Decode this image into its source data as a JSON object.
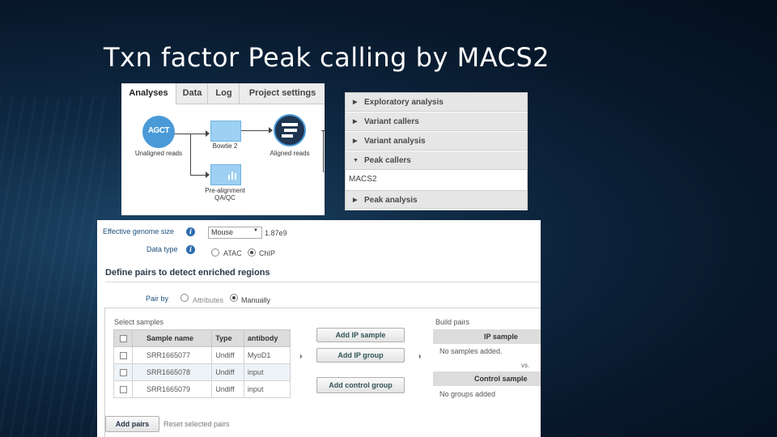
{
  "slide": {
    "title": "Txn factor Peak calling by MACS2"
  },
  "workflow": {
    "tabs": [
      {
        "label": "Analyses"
      },
      {
        "label": "Data"
      },
      {
        "label": "Log"
      },
      {
        "label": "Project settings"
      }
    ],
    "nodes": {
      "unaligned_label": "Unaligned reads",
      "unaligned_icon_text": "AGCT",
      "bowtie_label": "Bowtie 2",
      "aligned_label": "Aligned reads",
      "prealign_label_line1": "Pre-alignment",
      "prealign_label_line2": "QA/QC"
    }
  },
  "tools_menu": {
    "items": [
      {
        "label": "Exploratory analysis",
        "expanded": false
      },
      {
        "label": "Variant callers",
        "expanded": false
      },
      {
        "label": "Variant analysis",
        "expanded": false
      },
      {
        "label": "Peak callers",
        "expanded": true
      },
      {
        "label": "Peak analysis",
        "expanded": false
      }
    ],
    "subitem": "MACS2"
  },
  "settings": {
    "genome_size_label": "Effective genome size",
    "genome_select_value": "Mouse",
    "genome_size_value": "1.87e9",
    "data_type_label": "Data type",
    "data_type_options": [
      "ATAC",
      "ChIP"
    ],
    "data_type_selected": "ChIP",
    "section_title": "Define pairs to detect enriched regions",
    "pair_by_label": "Pair by",
    "pair_by_options": [
      "Attributes",
      "Manually"
    ],
    "pair_by_selected": "Manually",
    "select_samples_label": "Select samples",
    "table_headers": [
      "Sample name",
      "Type",
      "antibody"
    ],
    "samples": [
      {
        "name": "SRR1665077",
        "type": "Undiff",
        "antibody": "MyoD1"
      },
      {
        "name": "SRR1665078",
        "type": "Undiff",
        "antibody": "input"
      },
      {
        "name": "SRR1665079",
        "type": "Undiff",
        "antibody": "input"
      }
    ],
    "add_ip_sample": "Add IP sample",
    "add_ip_group": "Add IP group",
    "add_control_group": "Add control group",
    "build_pairs_label": "Build pairs",
    "ip_sample_header": "IP sample",
    "no_samples_text": "No samples added.",
    "vs_text": "vs.",
    "control_sample_header": "Control sample",
    "no_groups_text": "No groups added",
    "add_pairs": "Add pairs",
    "reset_pairs": "Reset selected pairs",
    "arrow_glyph": "›"
  },
  "colors": {
    "accent_blue": "#1d4f7c",
    "node_blue": "#9dd0f2",
    "icon_blue": "#4a9ad8"
  }
}
